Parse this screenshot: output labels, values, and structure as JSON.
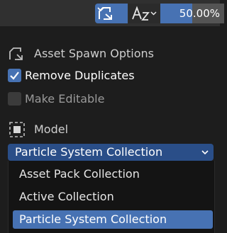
{
  "toolbar": {
    "spawn_button_icon": "asset-spawn-icon",
    "spawn_chevron_icon": "chevron-down-icon",
    "sort_icon": "sort-az-icon",
    "sort_chevron_icon": "chevron-down-icon",
    "zoom_value": "50.00%",
    "zoom_fraction": 0.5
  },
  "asset_spawn": {
    "title": "Asset Spawn Options",
    "icon": "asset-spawn-icon",
    "remove_duplicates": {
      "label": "Remove Duplicates",
      "checked": true
    },
    "make_editable": {
      "label": "Make Editable",
      "checked": false
    }
  },
  "model": {
    "title": "Model",
    "icon": "model-icon",
    "collection_selected": "Particle System Collection",
    "options": [
      {
        "label": "Asset Pack Collection",
        "selected": false
      },
      {
        "label": "Active Collection",
        "selected": false
      },
      {
        "label": "Particle System Collection",
        "selected": true
      }
    ]
  },
  "colors": {
    "accent": "#4772b3",
    "dropdown_bg": "#2a4e88",
    "panel_bg": "#1d1d1d",
    "toolbar_bg": "#303030",
    "menu_bg": "#141414"
  }
}
